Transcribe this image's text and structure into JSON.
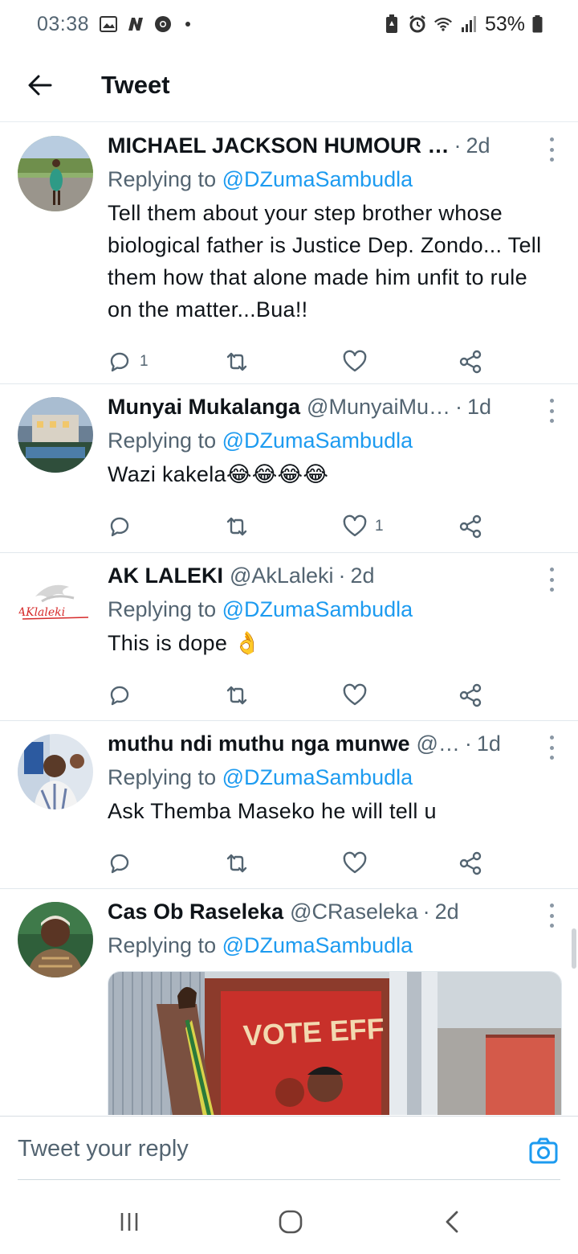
{
  "status_bar": {
    "time": "03:38",
    "battery": "53%",
    "icons": [
      "gallery-icon",
      "n-app-icon",
      "chrome-icon",
      "dot-icon",
      "battery-saver-icon",
      "alarm-icon",
      "wifi-icon",
      "signal-icon",
      "battery-icon"
    ]
  },
  "header": {
    "title": "Tweet",
    "back_icon": "arrow-left-icon"
  },
  "tweets": [
    {
      "name": "MICHAEL JACKSON HUMOUR …",
      "handle": "",
      "time": "2d",
      "replying_prefix": "Replying to",
      "replying_to": "@DZumaSambudla",
      "body": "Tell them about your step brother whose biological father is Justice Dep. Zondo... Tell them how that alone made him unfit to rule on the matter...Bua!!",
      "reply_count": "1",
      "retweet_count": "",
      "like_count": ""
    },
    {
      "name": "Munyai Mukalanga",
      "handle": "@MunyaiMu…",
      "time": "1d",
      "replying_prefix": "Replying to",
      "replying_to": "@DZumaSambudla",
      "body": "Wazi kakela😂😂😂😂",
      "reply_count": "",
      "retweet_count": "",
      "like_count": "1"
    },
    {
      "name": "AK LALEKI",
      "handle": "@AkLaleki",
      "time": "2d",
      "replying_prefix": "Replying to",
      "replying_to": "@DZumaSambudla",
      "body": "This is dope 👌",
      "reply_count": "",
      "retweet_count": "",
      "like_count": ""
    },
    {
      "name": "muthu ndi muthu nga munwe",
      "handle": "@…",
      "time": "1d",
      "replying_prefix": "Replying to",
      "replying_to": "@DZumaSambudla",
      "body": "Ask Themba Maseko he will tell u",
      "reply_count": "",
      "retweet_count": "",
      "like_count": ""
    },
    {
      "name": "Cas Ob Raseleka",
      "handle": "@CRaseleka",
      "time": "2d",
      "replying_prefix": "Replying to",
      "replying_to": "@DZumaSambudla",
      "media_text": "VOTE EFF"
    }
  ],
  "ak_logo_text": "AKlaleki",
  "reply_bar": {
    "placeholder": "Tweet your reply",
    "camera_icon": "camera-icon"
  },
  "nav_bar": {
    "icons": [
      "recent-apps-icon",
      "home-icon",
      "back-icon"
    ]
  },
  "colors": {
    "accent": "#1d9bf0",
    "secondary_text": "#536471",
    "primary_text": "#0f1419"
  }
}
